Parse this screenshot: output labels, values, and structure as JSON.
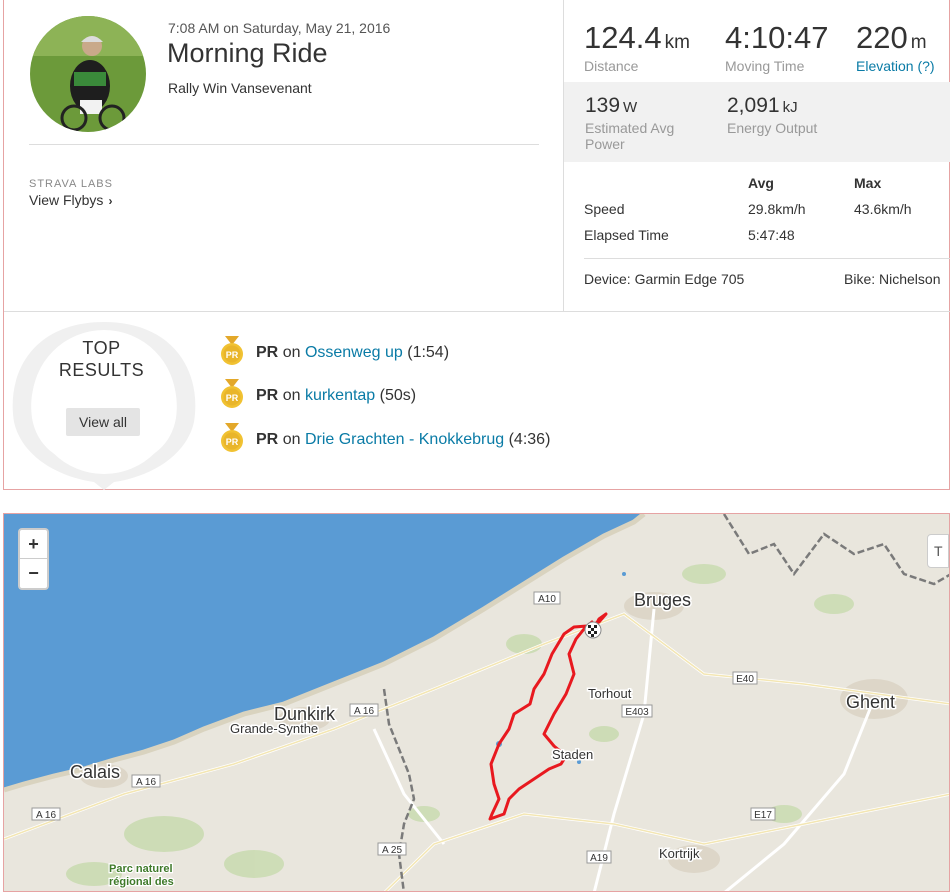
{
  "activity": {
    "date": "7:08 AM on Saturday, May 21, 2016",
    "title": "Morning Ride",
    "description": "Rally Win Vansevenant",
    "labs_label": "STRAVA LABS",
    "flybys_label": "View Flybys"
  },
  "stats": {
    "distance": {
      "value": "124.4",
      "unit": "km",
      "label": "Distance"
    },
    "moving_time": {
      "value": "4:10:47",
      "label": "Moving Time"
    },
    "elevation": {
      "value": "220",
      "unit": "m",
      "label": "Elevation (?)"
    },
    "power": {
      "value": "139",
      "unit": "W",
      "label": "Estimated Avg Power"
    },
    "energy": {
      "value": "2,091",
      "unit": "kJ",
      "label": "Energy Output"
    }
  },
  "table": {
    "headers": [
      "Avg",
      "Max"
    ],
    "rows": [
      {
        "label": "Speed",
        "avg": "29.8km/h",
        "max": "43.6km/h"
      },
      {
        "label": "Elapsed Time",
        "avg": "5:47:48",
        "max": ""
      }
    ]
  },
  "device": "Device: Garmin Edge 705",
  "bike": "Bike: Nichelson",
  "top_results": {
    "title_line1": "TOP",
    "title_line2": "RESULTS",
    "view_all": "View all",
    "medal_text": "PR",
    "items": [
      {
        "badge": "PR",
        "on": "on",
        "segment": "Ossenweg up",
        "time": "(1:54)"
      },
      {
        "badge": "PR",
        "on": "on",
        "segment": "kurkentap",
        "time": "(50s)"
      },
      {
        "badge": "PR",
        "on": "on",
        "segment": "Drie Grachten - Knokkebrug",
        "time": "(4:36)"
      }
    ]
  },
  "map": {
    "zoom_in": "+",
    "zoom_out": "−",
    "control_label": "T",
    "cities": [
      "Bruges",
      "Ghent",
      "Dunkirk",
      "Grande-Synthe",
      "Calais",
      "Torhout",
      "Staden",
      "Kortrijk"
    ],
    "roads": [
      "A10",
      "E40",
      "E403",
      "A 16",
      "A 16",
      "A 16",
      "E17",
      "A 25",
      "A19"
    ],
    "park": [
      "Parc naturel",
      "régional des"
    ],
    "colors": {
      "sea": "#5a9bd4",
      "land": "#e9e6dd",
      "route": "#e8191f",
      "border": "#7a7a7a"
    }
  }
}
